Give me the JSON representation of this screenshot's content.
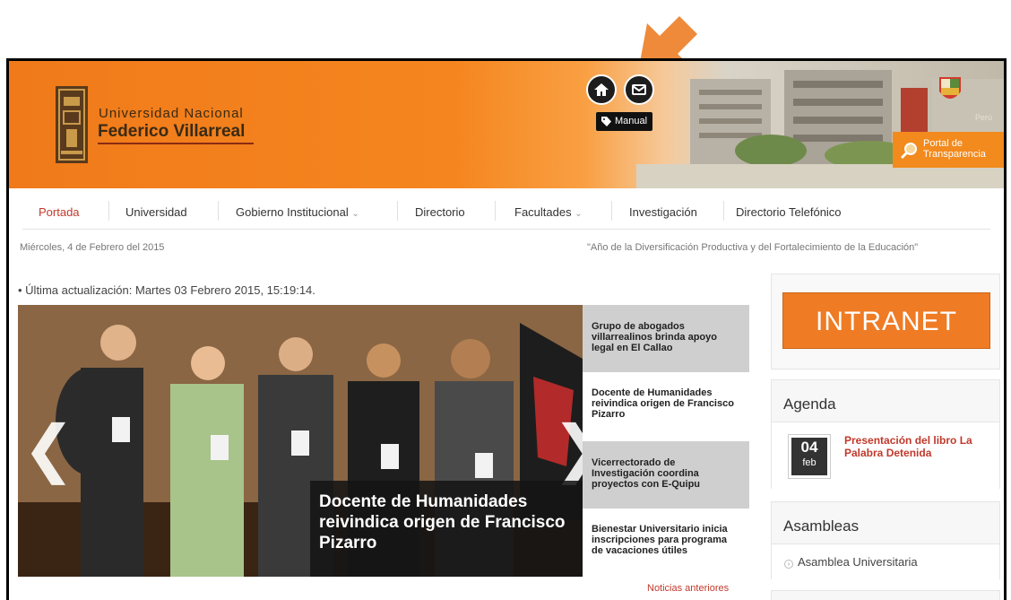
{
  "header": {
    "university_line1": "Universidad Nacional",
    "university_line2": "Federico Villarreal",
    "manual_label": "Manual",
    "country_text": "Perú",
    "transparency_button": "Portal de Transparencia"
  },
  "nav": {
    "items": [
      {
        "label": "Portada",
        "active": true
      },
      {
        "label": "Universidad"
      },
      {
        "label": "Gobierno Institucional",
        "has_dropdown": true
      },
      {
        "label": "Directorio"
      },
      {
        "label": "Facultades",
        "has_dropdown": true
      },
      {
        "label": "Investigación"
      },
      {
        "label": "Directorio Telefónico"
      }
    ],
    "dropdown_caret": "⌄"
  },
  "date_bar": {
    "date": "Miércoles, 4 de Febrero del 2015",
    "motto": "\"Año de la Diversificación Productiva y del Fortalecimiento de la Educación\""
  },
  "last_update": "• Última actualización: Martes 03 Febrero 2015, 15:19:14.",
  "slider": {
    "caption": "Docente de Humanidades reivindica origen de Francisco Pizarro",
    "prev_glyph": "❮",
    "next_glyph": "❯"
  },
  "headlines": [
    {
      "text": "Grupo de abogados villarrealinos brinda apoyo legal en El Callao"
    },
    {
      "text": "Docente de Humanidades reivindica origen de Francisco Pizarro"
    },
    {
      "text": "Vicerrectorado de Investigación coordina proyectos con E-Quipu"
    },
    {
      "text": "Bienestar Universitario inicia inscripciones para programa de vacaciones útiles"
    }
  ],
  "older_news_link": "Noticias anteriores",
  "sidebar": {
    "intranet_label": "INTRANET",
    "agenda_title": "Agenda",
    "agenda_event": {
      "day": "04",
      "month": "feb",
      "title": "Presentación del libro La Palabra Detenida"
    },
    "asambleas_title": "Asambleas",
    "asambleas_item": "Asamblea Universitaria"
  },
  "colors": {
    "brand_orange": "#f5861f",
    "nav_active": "#c0392b",
    "link_red": "#c0392b",
    "annotation_arrow": "#ee8a3a"
  },
  "icons": [
    "home-icon",
    "mail-icon",
    "tag-icon",
    "search-magnifier-icon",
    "peru-crest-icon",
    "annotation-arrow-icon"
  ]
}
